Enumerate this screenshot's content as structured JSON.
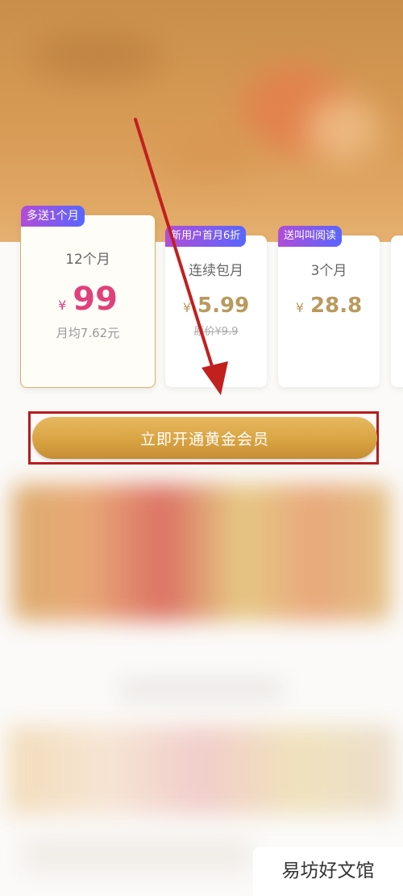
{
  "plans": [
    {
      "tag": "多送1个月",
      "name": "12个月",
      "currency": "¥",
      "price": "99",
      "sub": "月均7.62元",
      "selected": true
    },
    {
      "tag": "新用户首月6折",
      "name": "连续包月",
      "currency": "¥",
      "price": "5.99",
      "sub": "原价¥9.9",
      "selected": false
    },
    {
      "tag": "送叫叫阅读",
      "name": "3个月",
      "currency": "¥",
      "price": "28.8",
      "sub": "",
      "selected": false
    }
  ],
  "cta": {
    "label": "立即开通黄金会员"
  },
  "watermark": {
    "text": "易坊好文馆"
  },
  "colors": {
    "accent_price": "#e0417a",
    "gold_button": "#d9a443",
    "highlight_box": "#b61c1c",
    "arrow": "#c21f1f"
  }
}
